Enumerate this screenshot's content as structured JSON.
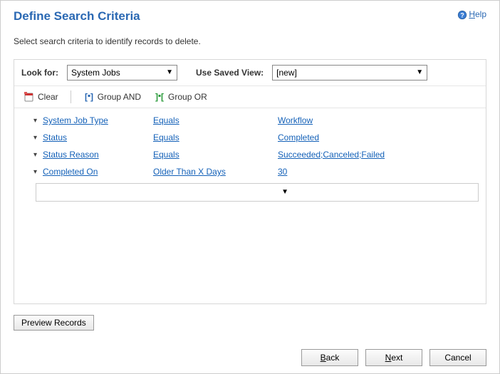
{
  "header": {
    "title": "Define Search Criteria",
    "help_label": "elp",
    "help_prefix": "H"
  },
  "subtitle": "Select search criteria to identify records to delete.",
  "filters": {
    "look_for_label": "Look for:",
    "look_for_value": "System Jobs",
    "saved_view_label": "Use Saved View:",
    "saved_view_value": "[new]"
  },
  "toolbar": {
    "clear_label": "Clear",
    "group_and_label": "Group AND",
    "group_or_label": "Group OR"
  },
  "criteria": [
    {
      "field": "System Job Type",
      "operator": "Equals",
      "value": "Workflow"
    },
    {
      "field": "Status",
      "operator": "Equals",
      "value": "Completed"
    },
    {
      "field": "Status Reason",
      "operator": "Equals",
      "value": "Succeeded;Canceled;Failed"
    },
    {
      "field": "Completed On",
      "operator": "Older Than X Days",
      "value": "30"
    }
  ],
  "buttons": {
    "preview_label": "Preview Records",
    "back_prefix": "B",
    "back_rest": "ack",
    "next_prefix": "N",
    "next_rest": "ext",
    "cancel_label": "Cancel"
  }
}
